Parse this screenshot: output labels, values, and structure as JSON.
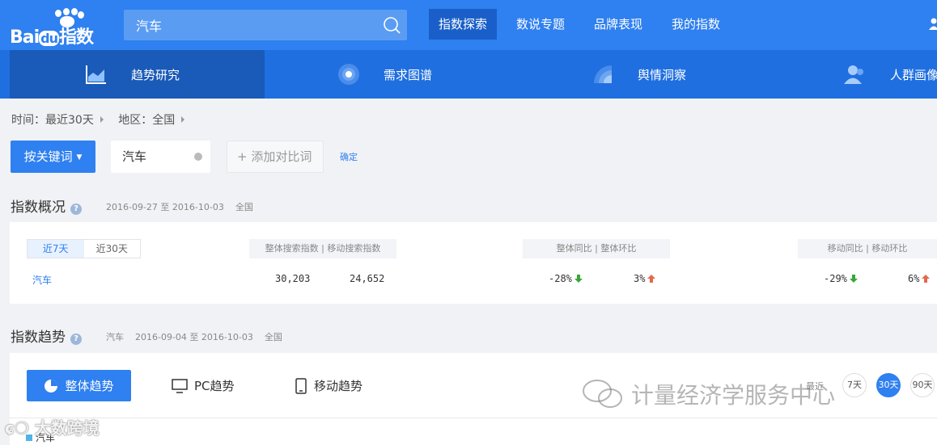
{
  "logo": {
    "text_left": "Bai",
    "text_mid": "du",
    "text_right": "指数"
  },
  "search": {
    "value": "汽车",
    "icon": "search-icon"
  },
  "nav": [
    {
      "label": "指数探索",
      "active": true
    },
    {
      "label": "数说专题",
      "active": false
    },
    {
      "label": "品牌表现",
      "active": false
    },
    {
      "label": "我的指数",
      "active": false
    }
  ],
  "subnav": [
    {
      "label": "趋势研究",
      "icon": "area-chart-icon",
      "active": true
    },
    {
      "label": "需求图谱",
      "icon": "radar-icon",
      "active": false
    },
    {
      "label": "舆情洞察",
      "icon": "signal-icon",
      "active": false
    },
    {
      "label": "人群画像",
      "icon": "people-icon",
      "active": false
    }
  ],
  "filters": {
    "time": "时间：最近30天",
    "region": "地区：全国"
  },
  "keyword_mode": "按关键词",
  "keyword": "汽车",
  "add_compare": "+ 添加对比词",
  "confirm": "确定",
  "overview": {
    "title": "指数概况",
    "date_range": "2016-09-27 至 2016-10-03",
    "region": "全国",
    "periods": [
      "近7天",
      "近30天"
    ],
    "headers": {
      "search": "整体搜索指数  |  移动搜索指数",
      "overall": "整体同比  |  整体环比",
      "mobile": "移动同比  |  移动环比"
    },
    "row": {
      "keyword": "汽车",
      "overall_index": "30,203",
      "mobile_index": "24,652",
      "overall_yoy": "-28%",
      "overall_mom": "3%",
      "mobile_yoy": "-29%",
      "mobile_mom": "6%"
    },
    "colors": {
      "down": "#3aa63a",
      "up": "#e4684b"
    }
  },
  "trend": {
    "title": "指数趋势",
    "keyword": "汽车",
    "date_range": "2016-09-04 至 2016-10-03",
    "region": "全国",
    "tabs": [
      "整体趋势",
      "PC趋势",
      "移动趋势"
    ],
    "range_label": "最近",
    "ranges": [
      "7天",
      "30天",
      "90天"
    ],
    "legend": "汽车"
  },
  "watermark": "计量经济学服务中心",
  "watermark2": "大数跨境"
}
